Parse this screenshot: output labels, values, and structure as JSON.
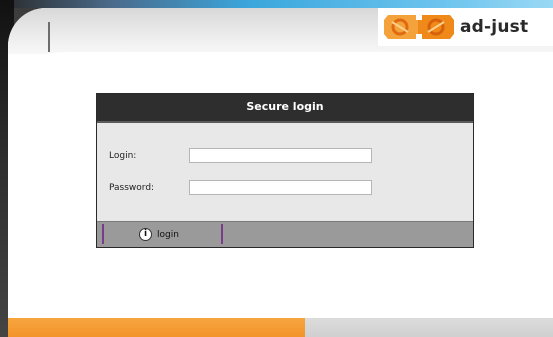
{
  "brand": {
    "name": "ad-just",
    "colors": {
      "orange": "#f08a1c",
      "dark": "#2e2e2e"
    }
  },
  "dialog": {
    "title": "Secure login",
    "fields": {
      "login_label": "Login:",
      "login_value": "",
      "password_label": "Password:",
      "password_value": ""
    },
    "submit": {
      "icon": "info-circle-icon",
      "label": "login"
    }
  }
}
